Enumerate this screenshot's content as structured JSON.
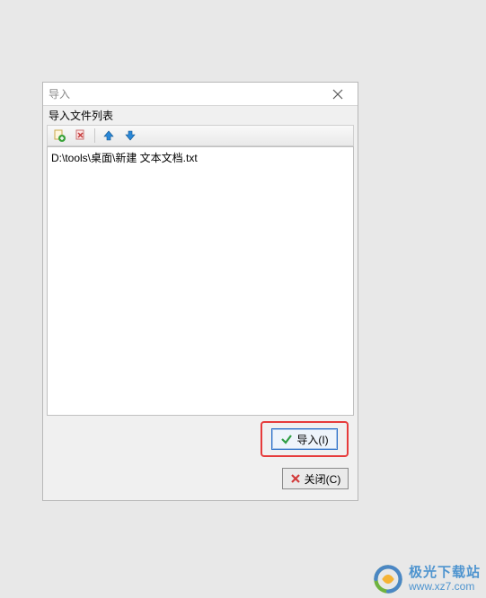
{
  "dialog": {
    "title": "导入",
    "section_label": "导入文件列表",
    "toolbar": {
      "icons": [
        "add-file-icon",
        "remove-file-icon",
        "move-up-icon",
        "move-down-icon"
      ]
    },
    "files": [
      "D:\\tools\\桌面\\新建 文本文档.txt"
    ],
    "buttons": {
      "import_label": "导入(I)",
      "close_label": "关闭(C)"
    },
    "window_close": "×"
  },
  "watermark": {
    "line1": "极光下载站",
    "line2": "www.xz7.com"
  },
  "colors": {
    "highlight": "#e63b3b",
    "accent_blue": "#2a6fc9",
    "check_green": "#2f9e44",
    "x_red": "#d23b3b",
    "arrow_blue": "#2a88d8",
    "wm_blue": "#4e94cf"
  }
}
